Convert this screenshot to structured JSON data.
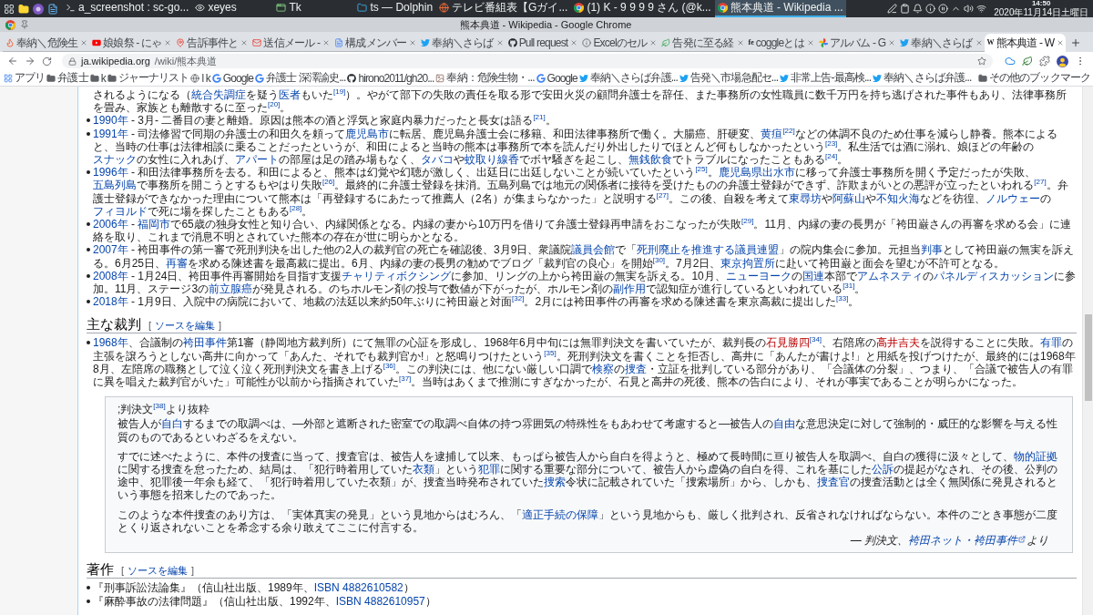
{
  "taskbar": {
    "tasks": [
      {
        "kind": "terminal",
        "label": "a_screenshot : sc-go...",
        "selected": false
      },
      {
        "kind": "eyes",
        "label": "xeyes",
        "selected": false
      },
      {
        "kind": "window",
        "label": "Tk",
        "selected": false
      },
      {
        "kind": "folder",
        "label": "ts — Dolphin",
        "selected": false
      },
      {
        "kind": "globe",
        "label": "テレビ番組表【Gガイ...",
        "selected": false
      },
      {
        "kind": "browser",
        "label": "(1) K - 9 9 9 9 さん (@k...",
        "selected": false
      },
      {
        "kind": "browser",
        "label": "熊本典道 - Wikipedia ...",
        "selected": true
      }
    ],
    "clock": {
      "time": "14:50",
      "date": "2020年11月14日土曜日"
    }
  },
  "window": {
    "title": "熊本典道 - Wikipedia - Google Chrome"
  },
  "tabs": [
    {
      "kind": "flame",
      "label": "奉納＼危険生",
      "selected": false
    },
    {
      "kind": "play",
      "label": "娘娘祭 - にゃ",
      "selected": false
    },
    {
      "kind": "pin",
      "label": "告訴事件と",
      "selected": false
    },
    {
      "kind": "mail",
      "label": "送信メール -",
      "selected": false
    },
    {
      "kind": "doc",
      "label": "構成メンバー",
      "selected": false
    },
    {
      "kind": "bird",
      "label": "奉納＼さらば",
      "selected": false
    },
    {
      "kind": "octocat",
      "label": "Pull request",
      "selected": false
    },
    {
      "kind": "info",
      "label": "Excelのセル",
      "selected": false
    },
    {
      "kind": "leaf",
      "label": "告発に至る経",
      "selected": false
    },
    {
      "kind": "letters",
      "icon_text": "fe",
      "label": "coggleとは",
      "selected": false
    },
    {
      "kind": "pinwheel",
      "label": "アルバム - G",
      "selected": false
    },
    {
      "kind": "bird",
      "label": "奉納＼さらば",
      "selected": false
    },
    {
      "kind": "letters",
      "icon_text": "W",
      "label": "熊本典道 - W",
      "selected": true
    }
  ],
  "address_bar": {
    "host": "ja.wikipedia.org",
    "path": "/wiki/熊本典道"
  },
  "bookmarks": [
    {
      "kind": "apps",
      "label": "アプリ"
    },
    {
      "kind": "folder",
      "label": "弁護士"
    },
    {
      "kind": "folder",
      "label": "k"
    },
    {
      "kind": "folder",
      "label": "ジャーナリスト"
    },
    {
      "kind": "globe",
      "label": "l k"
    },
    {
      "kind": "google",
      "label": "Google"
    },
    {
      "kind": "google",
      "label": "弁護士 深澤諭史..."
    },
    {
      "kind": "github",
      "label": "hirono2011/gh20..."
    },
    {
      "kind": "image",
      "label": "奉納：危険生物・..."
    },
    {
      "kind": "google",
      "label": "Google"
    },
    {
      "kind": "twitter",
      "label": "奉納＼さらば弁護..."
    },
    {
      "kind": "twitter",
      "label": "告発＼市場急配セ..."
    },
    {
      "kind": "twitter",
      "label": "非常上告-最高検..."
    },
    {
      "kind": "twitter",
      "label": "奉納＼さらば弁護..."
    }
  ],
  "other_bookmarks": {
    "kind": "folder",
    "label": "その他のブックマーク"
  },
  "timeline": [
    {
      "kind": "continuation",
      "segments": [
        {
          "kind": "text",
          "text": "されるようになる（"
        },
        {
          "kind": "link",
          "text": "統合失調症"
        },
        {
          "kind": "text",
          "text": "を疑う"
        },
        {
          "kind": "link",
          "text": "医者"
        },
        {
          "kind": "text",
          "text": "もいた"
        },
        {
          "kind": "ref",
          "text": "[19]"
        },
        {
          "kind": "text",
          "text": "）。やがて部下の失敗の責任を取る形で安田火災の顧問弁護士を辞任、また事務所の女性職員に数千万円を持ち逃げされた事件もあり、法律事務所を畳み、家族とも離散するに至った"
        },
        {
          "kind": "ref",
          "text": "[20]"
        },
        {
          "kind": "text",
          "text": "。"
        }
      ]
    },
    {
      "kind": "entry",
      "segments": [
        {
          "kind": "link",
          "text": "1990年"
        },
        {
          "kind": "text",
          "text": " - 3月- 二番目の妻と離婚。原因は熊本の酒と浮気と家庭内暴力だったと長女は語る"
        },
        {
          "kind": "ref",
          "text": "[21]"
        },
        {
          "kind": "text",
          "text": "。"
        }
      ]
    },
    {
      "kind": "entry",
      "segments": [
        {
          "kind": "link",
          "text": "1991年"
        },
        {
          "kind": "text",
          "text": " - 司法修習で同期の弁護士の和田久を頼って"
        },
        {
          "kind": "link",
          "text": "鹿児島市"
        },
        {
          "kind": "text",
          "text": "に転居、鹿児島弁護士会に移籍、和田法律事務所で働く。大腸癌、肝硬変、"
        },
        {
          "kind": "link",
          "text": "黄疸"
        },
        {
          "kind": "ref",
          "text": "[22]"
        },
        {
          "kind": "text",
          "text": "などの体調不良のため仕事を減らし静養。熊本によると、当時の仕事は法律相談に乗ることだったというが、和田によると当時の熊本は事務所で本を読んだり外出したりでほとんど何もしなかったという"
        },
        {
          "kind": "ref",
          "text": "[23]"
        },
        {
          "kind": "text",
          "text": "。私生活では酒に溺れ、娘ほどの年齢の"
        },
        {
          "kind": "link",
          "text": "スナック"
        },
        {
          "kind": "text",
          "text": "の女性に入れあげ、"
        },
        {
          "kind": "link",
          "text": "アパート"
        },
        {
          "kind": "text",
          "text": "の部屋は足の踏み場もなく、"
        },
        {
          "kind": "link",
          "text": "タバコ"
        },
        {
          "kind": "text",
          "text": "や"
        },
        {
          "kind": "link",
          "text": "蚊取り線香"
        },
        {
          "kind": "text",
          "text": "でボヤ騒ぎを起こし、"
        },
        {
          "kind": "link",
          "text": "無銭飲食"
        },
        {
          "kind": "text",
          "text": "でトラブルになったこともある"
        },
        {
          "kind": "ref",
          "text": "[24]"
        },
        {
          "kind": "text",
          "text": "。"
        }
      ]
    },
    {
      "kind": "entry",
      "segments": [
        {
          "kind": "link",
          "text": "1996年"
        },
        {
          "kind": "text",
          "text": " - 和田法律事務所を去る。和田によると、熊本は幻覚や幻聴が激しく、出廷日に出廷しないことが続いていたという"
        },
        {
          "kind": "ref",
          "text": "[25]"
        },
        {
          "kind": "text",
          "text": "。"
        },
        {
          "kind": "link",
          "text": "鹿児島県出水市"
        },
        {
          "kind": "text",
          "text": "に移って弁護士事務所を開く予定だったが失敗、"
        },
        {
          "kind": "link",
          "text": "五島列島"
        },
        {
          "kind": "text",
          "text": "で事務所を開こうとするもやはり失敗"
        },
        {
          "kind": "ref",
          "text": "[26]"
        },
        {
          "kind": "text",
          "text": "。最終的に弁護士登録を抹消。五島列島では地元の関係者に接待を受けたものの弁護士登録ができず、詐欺まがいとの悪評が立ったといわれる"
        },
        {
          "kind": "ref",
          "text": "[27]"
        },
        {
          "kind": "text",
          "text": "。弁護士登録ができなかった理由について熊本は「再登録するにあたって推薦人（2名）が集まらなかった」と説明する"
        },
        {
          "kind": "ref",
          "text": "[27]"
        },
        {
          "kind": "text",
          "text": "。この後、自殺を考えて"
        },
        {
          "kind": "link",
          "text": "東尋坊"
        },
        {
          "kind": "text",
          "text": "や"
        },
        {
          "kind": "link",
          "text": "阿蘇山"
        },
        {
          "kind": "text",
          "text": "や"
        },
        {
          "kind": "link",
          "text": "不知火海"
        },
        {
          "kind": "text",
          "text": "などを彷徨、"
        },
        {
          "kind": "link",
          "text": "ノルウェー"
        },
        {
          "kind": "text",
          "text": "の"
        },
        {
          "kind": "link",
          "text": "フィヨルド"
        },
        {
          "kind": "text",
          "text": "で死に場を探したこともある"
        },
        {
          "kind": "ref",
          "text": "[28]"
        },
        {
          "kind": "text",
          "text": "。"
        }
      ]
    },
    {
      "kind": "entry",
      "segments": [
        {
          "kind": "link",
          "text": "2006年"
        },
        {
          "kind": "text",
          "text": " - "
        },
        {
          "kind": "link",
          "text": "福岡市"
        },
        {
          "kind": "text",
          "text": "で65歳の独身女性と知り合い、内縁関係となる。内縁の妻から10万円を借りて弁護士登録再申請をおこなったが失敗"
        },
        {
          "kind": "ref",
          "text": "[29]"
        },
        {
          "kind": "text",
          "text": "。11月、内縁の妻の長男が「袴田巌さんの再審を求める会」に連絡を取り、これまで消息不明とされていた熊本の存在が世に明らかとなる。"
        }
      ]
    },
    {
      "kind": "entry",
      "segments": [
        {
          "kind": "link",
          "text": "2007年"
        },
        {
          "kind": "text",
          "text": " - 袴田事件の第一審で死刑判決を出した他の2人の裁判官の死亡を確認後、3月9日、衆議院"
        },
        {
          "kind": "link",
          "text": "議員会館"
        },
        {
          "kind": "text",
          "text": "で「"
        },
        {
          "kind": "link",
          "text": "死刑廃止を推進する議員連盟"
        },
        {
          "kind": "text",
          "text": "」の院内集会に参加。元担当"
        },
        {
          "kind": "link",
          "text": "判事"
        },
        {
          "kind": "text",
          "text": "として袴田巌の無実を訴える。6月25日、"
        },
        {
          "kind": "link",
          "text": "再審"
        },
        {
          "kind": "text",
          "text": "を求める陳述書を最高裁に提出。6月、内縁の妻の長男の勧めでブログ「裁判官の良心」を開始"
        },
        {
          "kind": "ref",
          "text": "[30]"
        },
        {
          "kind": "text",
          "text": "。7月2日、"
        },
        {
          "kind": "link",
          "text": "東京拘置所"
        },
        {
          "kind": "text",
          "text": "に赴いて袴田巌と面会を望むが不許可となる。"
        }
      ]
    },
    {
      "kind": "entry",
      "segments": [
        {
          "kind": "link",
          "text": "2008年"
        },
        {
          "kind": "text",
          "text": " - 1月24日、袴田事件再審開始を目指す支援"
        },
        {
          "kind": "link",
          "text": "チャリティボクシング"
        },
        {
          "kind": "text",
          "text": "に参加、リングの上から袴田巌の無実を訴える。10月、"
        },
        {
          "kind": "link",
          "text": "ニューヨーク"
        },
        {
          "kind": "text",
          "text": "の"
        },
        {
          "kind": "link",
          "text": "国連"
        },
        {
          "kind": "text",
          "text": "本部で"
        },
        {
          "kind": "link",
          "text": "アムネスティ"
        },
        {
          "kind": "text",
          "text": "の"
        },
        {
          "kind": "link",
          "text": "パネルディスカッション"
        },
        {
          "kind": "text",
          "text": "に参加。11月、ステージ3の"
        },
        {
          "kind": "link",
          "text": "前立腺癌"
        },
        {
          "kind": "text",
          "text": "が発見される。のちホルモン剤の投与で数値が下がったが、ホルモン剤の"
        },
        {
          "kind": "link",
          "text": "副作用"
        },
        {
          "kind": "text",
          "text": "で認知症が進行しているといわれている"
        },
        {
          "kind": "ref",
          "text": "[31]"
        },
        {
          "kind": "text",
          "text": "。"
        }
      ]
    },
    {
      "kind": "entry",
      "segments": [
        {
          "kind": "link",
          "text": "2018年"
        },
        {
          "kind": "text",
          "text": " - 1月9日、入院中の病院において、地裁の法廷以来約50年ぶりに袴田巌と対面"
        },
        {
          "kind": "ref",
          "text": "[32]"
        },
        {
          "kind": "text",
          "text": "。2月には袴田事件の再審を求める陳述書を東京高裁に提出した"
        },
        {
          "kind": "ref",
          "text": "[33]"
        },
        {
          "kind": "text",
          "text": "。"
        }
      ]
    }
  ],
  "sections": [
    {
      "heading": "主な裁判",
      "edit_link": {
        "open": "[",
        "label": "ソースを編集",
        "close": "]"
      },
      "items": [
        {
          "kind": "entry",
          "segments": [
            {
              "kind": "link",
              "text": "1968年"
            },
            {
              "kind": "text",
              "text": "、合議制の"
            },
            {
              "kind": "link",
              "text": "袴田事件"
            },
            {
              "kind": "text",
              "text": "第1審（静岡地方裁判所）にて無罪の心証を形成し、1968年6月中旬には無罪判決文を書いていたが、裁判長の"
            },
            {
              "kind": "redlink",
              "text": "石見勝四"
            },
            {
              "kind": "ref",
              "text": "[34]"
            },
            {
              "kind": "text",
              "text": "、右陪席の"
            },
            {
              "kind": "redlink",
              "text": "高井吉夫"
            },
            {
              "kind": "text",
              "text": "を説得することに失敗。"
            },
            {
              "kind": "link",
              "text": "有罪"
            },
            {
              "kind": "text",
              "text": "の主張を譲ろうとしない高井に向かって「あんた、それでも裁判官か!」と怒鳴りつけたという"
            },
            {
              "kind": "ref",
              "text": "[35]"
            },
            {
              "kind": "text",
              "text": "。死刑判決文を書くことを拒否し、高井に「あんたが書けよ!」と用紙を投げつけたが、最終的には1968年8月、左陪席の職務として泣く泣く死刑判決文を書き上げる"
            },
            {
              "kind": "ref",
              "text": "[36]"
            },
            {
              "kind": "text",
              "text": "。この判決には、他にない厳しい口調で"
            },
            {
              "kind": "link",
              "text": "検察"
            },
            {
              "kind": "text",
              "text": "の"
            },
            {
              "kind": "link",
              "text": "捜査"
            },
            {
              "kind": "text",
              "text": "・立証を批判している部分があり、「合議体の分裂」、つまり、「合議で被告人の有罪に異を唱えた裁判官がいた」可能性が以前から指摘されていた"
            },
            {
              "kind": "ref",
              "text": "[37]"
            },
            {
              "kind": "text",
              "text": "。当時はあくまで推測にすぎなかったが、石見と高井の死後、熊本の告白により、それが事実であることが明らかになった。"
            }
          ]
        }
      ],
      "quote": {
        "header": [
          {
            "kind": "text",
            "text": ";判決文"
          },
          {
            "kind": "ref",
            "text": "[38]"
          },
          {
            "kind": "text",
            "text": "より抜粋"
          }
        ],
        "paragraphs": [
          [
            {
              "kind": "text",
              "text": "被告人が"
            },
            {
              "kind": "link",
              "text": "自白"
            },
            {
              "kind": "text",
              "text": "するまでの取調べは、―外部と遮断された密室での取調べ自体の持つ雰囲気の特殊性をもあわせて考慮すると―被告人の"
            },
            {
              "kind": "link",
              "text": "自由"
            },
            {
              "kind": "text",
              "text": "な意思決定に対して強制的・威圧的な影響を与える性質のものであるといわざるをえない。"
            }
          ],
          [
            {
              "kind": "text",
              "text": "すでに述べたように、本件の捜査に当って、捜査官は、被告人を逮捕して以来、もっぱら被告人から自白を得ようと、極めて長時間に亘り被告人を取調べ、自白の獲得に汲々として、"
            },
            {
              "kind": "link",
              "text": "物的証拠"
            },
            {
              "kind": "text",
              "text": "に関する捜査を怠ったため、結局は、「犯行時着用していた"
            },
            {
              "kind": "link",
              "text": "衣類"
            },
            {
              "kind": "text",
              "text": "」という"
            },
            {
              "kind": "link",
              "text": "犯罪"
            },
            {
              "kind": "text",
              "text": "に関する重要な部分について、被告人から虚偽の自白を得、これを基にした"
            },
            {
              "kind": "link",
              "text": "公訴"
            },
            {
              "kind": "text",
              "text": "の提起がなされ、その後、公判の途中、犯罪後一年余も経て、「犯行時着用していた衣類」が、捜査当時発布されていた"
            },
            {
              "kind": "link",
              "text": "捜索"
            },
            {
              "kind": "text",
              "text": "令状に記載されていた「捜索場所」から、しかも、"
            },
            {
              "kind": "link",
              "text": "捜査官"
            },
            {
              "kind": "text",
              "text": "の捜査活動とは全く無関係に発見されるという事態を招来したのであった。"
            }
          ],
          [
            {
              "kind": "text",
              "text": "このような本件捜査のあり方は、「実体真実の発見」という見地からはむろん、「"
            },
            {
              "kind": "link",
              "text": "適正手続の保障"
            },
            {
              "kind": "text",
              "text": "」という見地からも、厳しく批判され、反省されなければならない。本件のごとき事態が二度とくり返されないことを希念する余り敢えてここに付言する。"
            }
          ]
        ],
        "attribution": {
          "prefix": "— 判決文、",
          "link": "袴田ネット・袴田事件",
          "suffix": "より"
        }
      }
    },
    {
      "heading": "著作",
      "edit_link": {
        "open": "[",
        "label": "ソースを編集",
        "close": "]"
      },
      "items": [
        {
          "kind": "entry",
          "segments": [
            {
              "kind": "text",
              "text": "『刑事訴訟法論集』（信山社出版、1989年、"
            },
            {
              "kind": "link",
              "text": "ISBN 4882610582"
            },
            {
              "kind": "text",
              "text": "）"
            }
          ]
        },
        {
          "kind": "entry",
          "segments": [
            {
              "kind": "text",
              "text": "『麻酔事故の法律問題』（信山社出版、1992年、"
            },
            {
              "kind": "link",
              "text": "ISBN 4882610957"
            },
            {
              "kind": "text",
              "text": "）"
            }
          ]
        }
      ]
    }
  ]
}
